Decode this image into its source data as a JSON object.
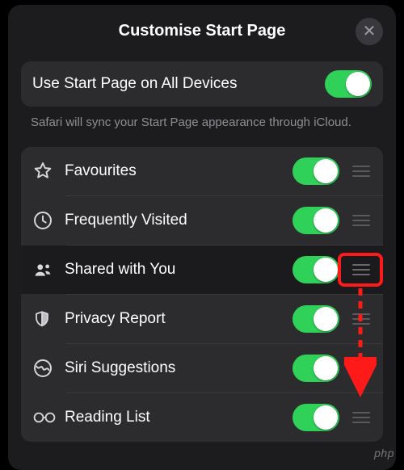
{
  "header": {
    "title": "Customise Start Page"
  },
  "sync": {
    "label": "Use Start Page on All Devices",
    "on": true,
    "note": "Safari will sync your Start Page appearance through iCloud."
  },
  "items": [
    {
      "icon": "star",
      "label": "Favourites",
      "on": true
    },
    {
      "icon": "clock",
      "label": "Frequently Visited",
      "on": true
    },
    {
      "icon": "people",
      "label": "Shared with You",
      "on": true,
      "active": true
    },
    {
      "icon": "shield",
      "label": "Privacy Report",
      "on": true
    },
    {
      "icon": "siri",
      "label": "Siri Suggestions",
      "on": true
    },
    {
      "icon": "glasses",
      "label": "Reading List",
      "on": true
    }
  ],
  "annotation": {
    "highlight_index": 2
  },
  "watermark": "php"
}
